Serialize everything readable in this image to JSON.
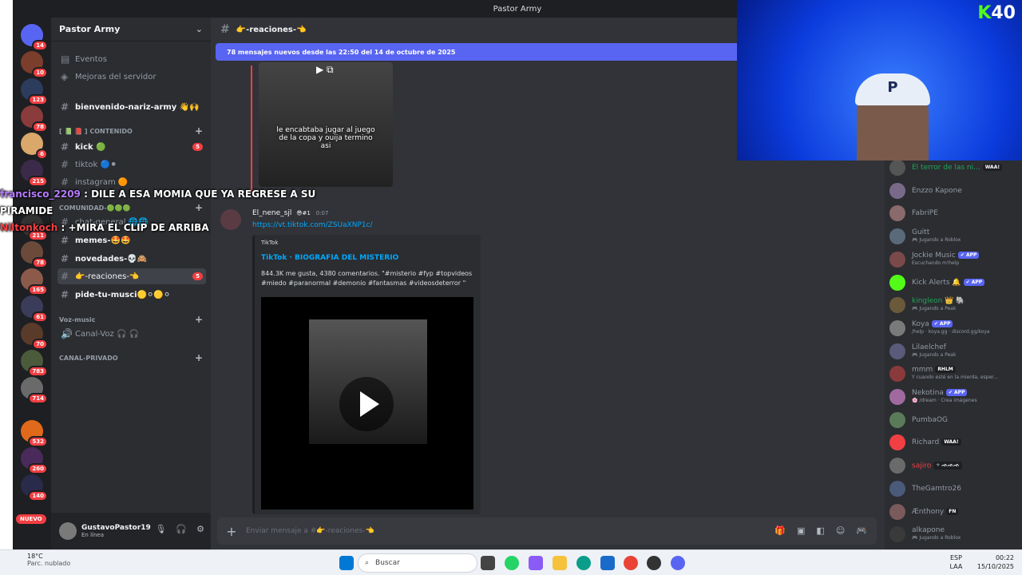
{
  "window": {
    "title": "Pastor Army"
  },
  "server_rail": {
    "badges": [
      "14",
      "10",
      "123",
      "78",
      "6",
      "215",
      "211",
      "78",
      "165",
      "61",
      "70",
      "783",
      "714",
      "532",
      "260",
      "140"
    ],
    "nuevo": "NUEVO"
  },
  "sidebar": {
    "guild_name": "Pastor Army",
    "events": "Eventos",
    "boosts": "Mejoras del servidor",
    "welcome": "bienvenido-nariz-army 👋🙌",
    "cat_content": "[ 📗 📕 ] CONTENIDO",
    "channels": [
      {
        "name": "kick 🟢",
        "unread": "5"
      },
      {
        "name": "tiktok 🔵⚫",
        "unread": ""
      },
      {
        "name": "instagram 🟠",
        "unread": ""
      }
    ],
    "cat_comunidad": "COMUNIDAD-🟢🟢🟢",
    "comunidad": [
      "chat-general 🌐🌐",
      "memes-🤩🤩",
      "novedades-💀🙈",
      "👉-reaciones-👈",
      "pide-tu-musci🟡⚪🟡⚪"
    ],
    "reaciones_unread": "5",
    "cat_voz": "Voz-music",
    "voice": "Canal-Voz 🎧 🎧",
    "cat_private": "CANAL-PRIVADO"
  },
  "user": {
    "name": "GustavoPastor19",
    "status": "En línea"
  },
  "channel": {
    "name": "👉-reaciones-👈",
    "new_messages": "78 mensajes nuevos desde las 22:50 del 14 de octubre de 2025",
    "video_caption": "le encabtaba jugar al juego de la copa y ouija termino asi"
  },
  "message": {
    "author": "El_nene_sjl",
    "badge": "😎#1",
    "time": "0:07",
    "link": "https://vt.tiktok.com/ZSUaXNP1c/",
    "embed": {
      "provider": "TikTok",
      "title": "TikTok · BIOGRAFIA DEL MISTERIO",
      "description": "844.3K me gusta, 4380 comentarios. \"#misterio #fyp #topvideos #miedo #paranormal #demonio #fantasmas #videosdeterror \""
    }
  },
  "composer": {
    "placeholder": "Enviar mensaje a #👉-reaciones-👈"
  },
  "members": [
    {
      "name": "El terror de las ni...",
      "sub": "",
      "tag": "WAA!",
      "color": "#23a55a"
    },
    {
      "name": "Enzzo Kapone",
      "sub": "",
      "tag": "",
      "color": "#949ba4"
    },
    {
      "name": "FabriPE",
      "sub": "",
      "tag": "",
      "color": "#949ba4"
    },
    {
      "name": "Guitt",
      "sub": "🎮 Jugando a Roblox",
      "tag": "",
      "color": "#949ba4"
    },
    {
      "name": "Jockie Music",
      "sub": "Escuchando m!help",
      "tag": "✔ APP",
      "color": "#949ba4"
    },
    {
      "name": "Kick Alerts 🔔",
      "sub": "",
      "tag": "✔ APP",
      "color": "#949ba4"
    },
    {
      "name": "kingleon 👑 🐘",
      "sub": "🎮 Jugando a Peak",
      "tag": "",
      "color": "#23a55a"
    },
    {
      "name": "Koya",
      "sub": "/help · koya.gg · discord.gg/koya",
      "tag": "✔ APP",
      "color": "#949ba4"
    },
    {
      "name": "Lilaelchef",
      "sub": "🎮 Jugando a Peak",
      "tag": "",
      "color": "#949ba4"
    },
    {
      "name": "mmm",
      "sub": "Y cuando esté en la mierda, esper...",
      "tag": "RHLM",
      "color": "#949ba4"
    },
    {
      "name": "Nekotina",
      "sub": "🌸 /dream · Crea imágenes",
      "tag": "✔ APP",
      "color": "#949ba4"
    },
    {
      "name": "PumbaOG",
      "sub": "",
      "tag": "",
      "color": "#949ba4"
    },
    {
      "name": "Richard",
      "sub": "",
      "tag": "WAA!",
      "color": "#949ba4"
    },
    {
      "name": "sajiro",
      "sub": "",
      "tag": "✧ ᨒᨒᨒ",
      "color": "#f23f43"
    },
    {
      "name": "TheGamtro26",
      "sub": "",
      "tag": "",
      "color": "#949ba4"
    },
    {
      "name": "Ænthony",
      "sub": "",
      "tag": "FN",
      "color": "#949ba4"
    },
    {
      "name": "alkapone",
      "sub": "🎮 Jugando a Roblox",
      "tag": "",
      "color": "#949ba4"
    }
  ],
  "stream_overlay": {
    "line1_user": "francisco_2209",
    "line1_text": ": DILE A ESA MOMIA QUE YA REGRESE A SU",
    "line1b": "PIRAMIDE",
    "line2_user": "Niltonkoch",
    "line2_text": ": +MIRA EL CLIP DE ARRIBA",
    "logo_k": "K",
    "logo_num": "40"
  },
  "taskbar": {
    "temp": "18°C",
    "weather": "Parc. nublado",
    "search": "Buscar",
    "lang1": "ESP",
    "lang2": "LAA",
    "time": "00:22",
    "date": "15/10/2025"
  }
}
